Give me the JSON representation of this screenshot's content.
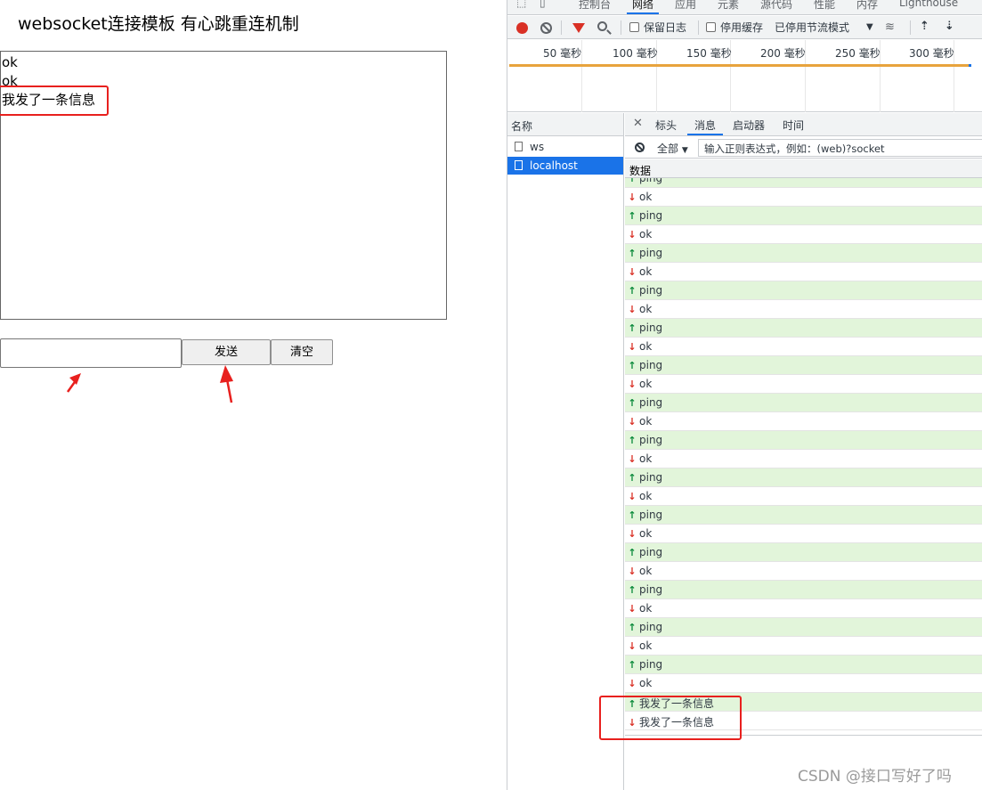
{
  "page": {
    "title": "websocket连接模板 有心跳重连机制",
    "messages": [
      "ok",
      "ok",
      "我发了一条信息"
    ],
    "input_value": "",
    "send_label": "发送",
    "clear_label": "清空"
  },
  "devtools": {
    "top_tabs": [
      "控制台",
      "网络",
      "应用",
      "元素",
      "源代码",
      "性能",
      "内存",
      "Lighthouse"
    ],
    "active_top_tab": "网络",
    "toolbar": {
      "preserve_log": "保留日志",
      "disable_cache": "停用缓存",
      "throttle": "已停用节流模式"
    },
    "timeline_labels": [
      "50 毫秒",
      "100 毫秒",
      "150 毫秒",
      "200 毫秒",
      "250 毫秒",
      "300 毫秒"
    ],
    "name_header": "名称",
    "requests": [
      {
        "name": "ws",
        "selected": false
      },
      {
        "name": "localhost",
        "selected": true
      }
    ],
    "detail_tabs": [
      "标头",
      "消息",
      "启动器",
      "时间"
    ],
    "active_detail_tab": "消息",
    "filter_select": "全部",
    "filter_placeholder": "输入正则表达式，例如：(web)?socket",
    "data_header": "数据",
    "frames": [
      {
        "dir": "sent",
        "text": "ping"
      },
      {
        "dir": "recv",
        "text": "ok"
      },
      {
        "dir": "sent",
        "text": "ping"
      },
      {
        "dir": "recv",
        "text": "ok"
      },
      {
        "dir": "sent",
        "text": "ping"
      },
      {
        "dir": "recv",
        "text": "ok"
      },
      {
        "dir": "sent",
        "text": "ping"
      },
      {
        "dir": "recv",
        "text": "ok"
      },
      {
        "dir": "sent",
        "text": "ping"
      },
      {
        "dir": "recv",
        "text": "ok"
      },
      {
        "dir": "sent",
        "text": "ping"
      },
      {
        "dir": "recv",
        "text": "ok"
      },
      {
        "dir": "sent",
        "text": "ping"
      },
      {
        "dir": "recv",
        "text": "ok"
      },
      {
        "dir": "sent",
        "text": "ping"
      },
      {
        "dir": "recv",
        "text": "ok"
      },
      {
        "dir": "sent",
        "text": "ping"
      },
      {
        "dir": "recv",
        "text": "ok"
      },
      {
        "dir": "sent",
        "text": "ping"
      },
      {
        "dir": "recv",
        "text": "ok"
      },
      {
        "dir": "sent",
        "text": "ping"
      },
      {
        "dir": "recv",
        "text": "ok"
      },
      {
        "dir": "sent",
        "text": "ping"
      },
      {
        "dir": "recv",
        "text": "ok"
      },
      {
        "dir": "sent",
        "text": "ping"
      },
      {
        "dir": "recv",
        "text": "ok"
      },
      {
        "dir": "sent",
        "text": "ping"
      },
      {
        "dir": "recv",
        "text": "ok"
      },
      {
        "dir": "sent",
        "text": "我发了一条信息"
      },
      {
        "dir": "recv",
        "text": "我发了一条信息"
      }
    ]
  },
  "colors": {
    "annotation_red": "#e8201e",
    "sent_bg": "#e2f5da",
    "selected_blue": "#1a73e8",
    "record_red": "#d93025"
  },
  "watermark": "CSDN @接口写好了吗"
}
